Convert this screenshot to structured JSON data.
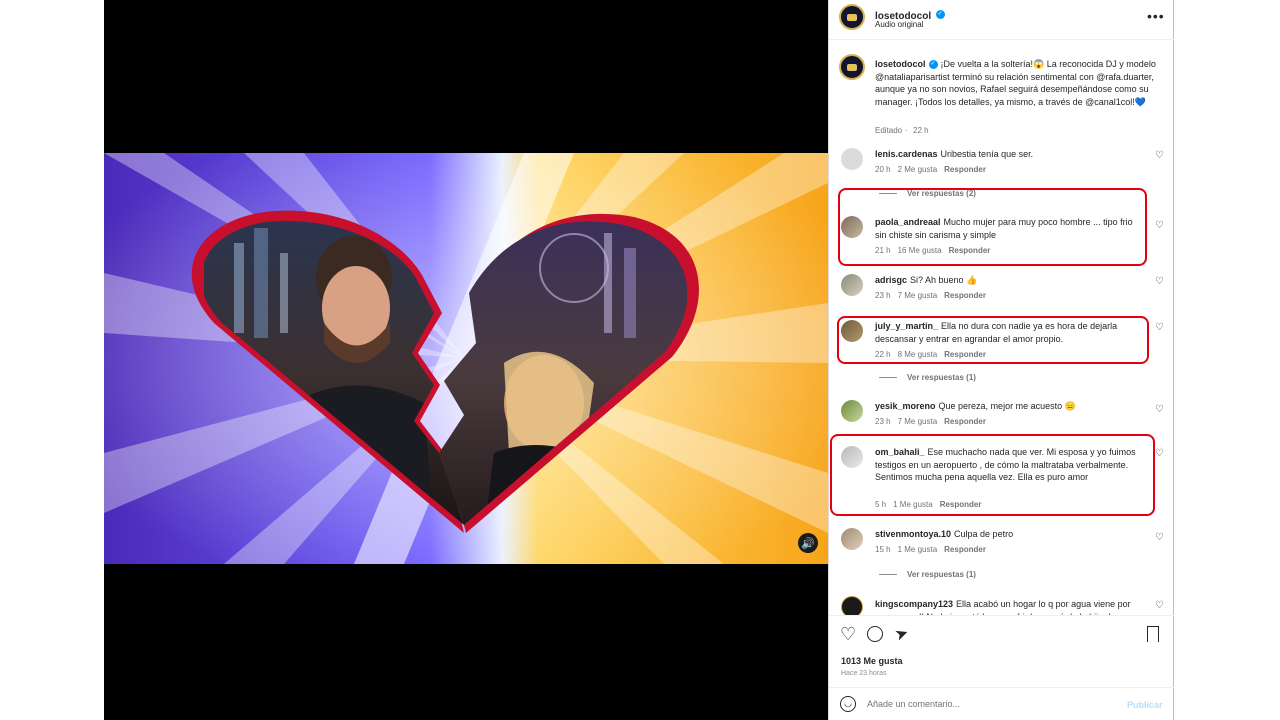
{
  "post": {
    "username": "losetodocol",
    "audio": "Audio original",
    "caption": "¡De vuelta a la soltería!😱 La reconocida DJ y modelo @nataliaparisartist terminó su relación sentimental con @rafa.duarter, aunque ya no son novios, Rafael seguirá desempeñándose como su manager. ¡Todos los detalles, ya mismo, a través de @canal1col!💙",
    "edited": "Editado",
    "edited_time": "22 h",
    "likes": "1013 Me gusta",
    "time_ago": "Hace 23 horas"
  },
  "comments": [
    {
      "user": "lenis.cardenas",
      "text": "Uribestia tenía que ser.",
      "time": "20 h",
      "likes": "2 Me gusta",
      "reply": "Responder"
    },
    {
      "user": "paola_andreaal",
      "text": "Mucho mujer para muy poco hombre ... tipo frio sin chiste sin carisma y simple",
      "time": "21 h",
      "likes": "16 Me gusta",
      "reply": "Responder"
    },
    {
      "user": "adrisgc",
      "text": "Si? Ah bueno 👍",
      "time": "23 h",
      "likes": "7 Me gusta",
      "reply": "Responder"
    },
    {
      "user": "july_y_martin_",
      "text": "Ella no dura con nadie ya es hora de dejarla descansar y entrar en agrandar el amor propio.",
      "time": "22 h",
      "likes": "8 Me gusta",
      "reply": "Responder"
    },
    {
      "user": "yesik_moreno",
      "text": "Que pereza, mejor me acuesto 😑",
      "time": "23 h",
      "likes": "7 Me gusta",
      "reply": "Responder"
    },
    {
      "user": "om_bahali_",
      "text": "Ese muchacho nada que ver. Mi esposa y yo fuimos testigos en un aeropuerto , de cómo la maltrataba verbalmente. Sentimos mucha pena aquella vez. Ella es puro amor",
      "time": "5 h",
      "likes": "1 Me gusta",
      "reply": "Responder"
    },
    {
      "user": "stivenmontoya.10",
      "text": "Culpa de petro",
      "time": "15 h",
      "likes": "1 Me gusta",
      "reply": "Responder"
    },
    {
      "user": "kingscompany123",
      "text": "Ella acabó un hogar lo q por agua viene por agua se va!! No le importó hacer sufrir la mamá de la hija de"
    }
  ],
  "view_replies": [
    "Ver respuestas (2)",
    "Ver respuestas (1)",
    "Ver respuestas (1)"
  ],
  "comment_input": {
    "placeholder": "Añade un comentario...",
    "publish": "Publicar"
  },
  "icons": {
    "more": "more-options-icon",
    "like": "heart-icon",
    "comment": "comment-icon",
    "share": "share-icon",
    "save": "bookmark-icon",
    "emoji": "emoji-icon",
    "sound": "speaker-icon"
  },
  "colors": {
    "highlight": "#e3000f",
    "verified": "#0095f6",
    "publish": "#b2dffc"
  }
}
